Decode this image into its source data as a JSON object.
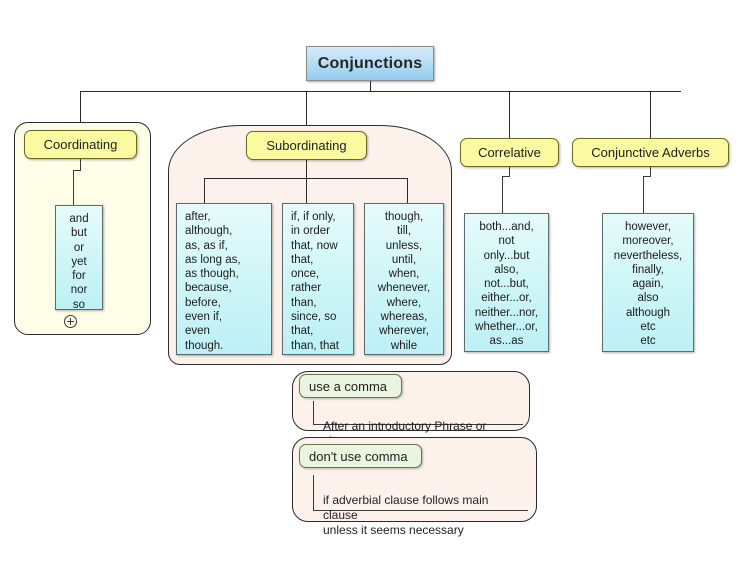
{
  "diagram": {
    "root": {
      "label": "Conjunctions"
    },
    "branches": [
      {
        "key": "coordinating",
        "header": "Coordinating",
        "lists": [
          {
            "key": "coord-list",
            "text": "and\nbut\nor\nyet\nfor\nnor\nso",
            "align": "center"
          }
        ],
        "expand_icon": "plus-circle-icon"
      },
      {
        "key": "subordinating",
        "header": "Subordinating",
        "lists": [
          {
            "key": "sub-list-1",
            "text": "after,\nalthough,\nas, as if,\nas long as,\nas though,\nbecause,\nbefore,\neven if,\neven\nthough.",
            "align": "left"
          },
          {
            "key": "sub-list-2",
            "text": "if, if only,\nin order\nthat, now\nthat,\nonce,\nrather\nthan,\nsince, so\nthat,\nthan, that",
            "align": "left"
          },
          {
            "key": "sub-list-3",
            "text": "though,\ntill,\nunless,\nuntil,\nwhen,\nwhenever,\nwhere,\nwhereas,\nwherever,\nwhile",
            "align": "center"
          }
        ]
      },
      {
        "key": "correlative",
        "header": "Correlative",
        "lists": [
          {
            "key": "corr-list",
            "text": "both...and,\nnot\nonly...but\nalso,\nnot...but,\neither...or,\nneither...nor,\nwhether...or,\nas...as",
            "align": "center"
          }
        ]
      },
      {
        "key": "conjunctive-adverbs",
        "header": "Conjunctive Adverbs",
        "lists": [
          {
            "key": "adv-list",
            "text": "however,\nmoreover,\nnevertheless,\nfinally,\nagain,\nalso\nalthough\netc\netc",
            "align": "center"
          }
        ]
      }
    ],
    "notes": [
      {
        "key": "use-comma",
        "header": "use a comma",
        "body": "After an introductory Phrase or clause"
      },
      {
        "key": "dont-use-comma",
        "header": "don't use comma",
        "body": "if adverbial clause follows main clause\nunless it seems necessary"
      }
    ]
  },
  "colors": {
    "root_fill_top": "#d3e9f9",
    "root_fill_bottom": "#93cbef",
    "header_fill": "#fbfaa0",
    "note_header_fill": "#e9f5df",
    "list_fill": "#cdf5f7",
    "coord_container_fill": "#fdfde8",
    "subord_container_fill": "#fdf1ec",
    "line": "#2b2b2b"
  }
}
